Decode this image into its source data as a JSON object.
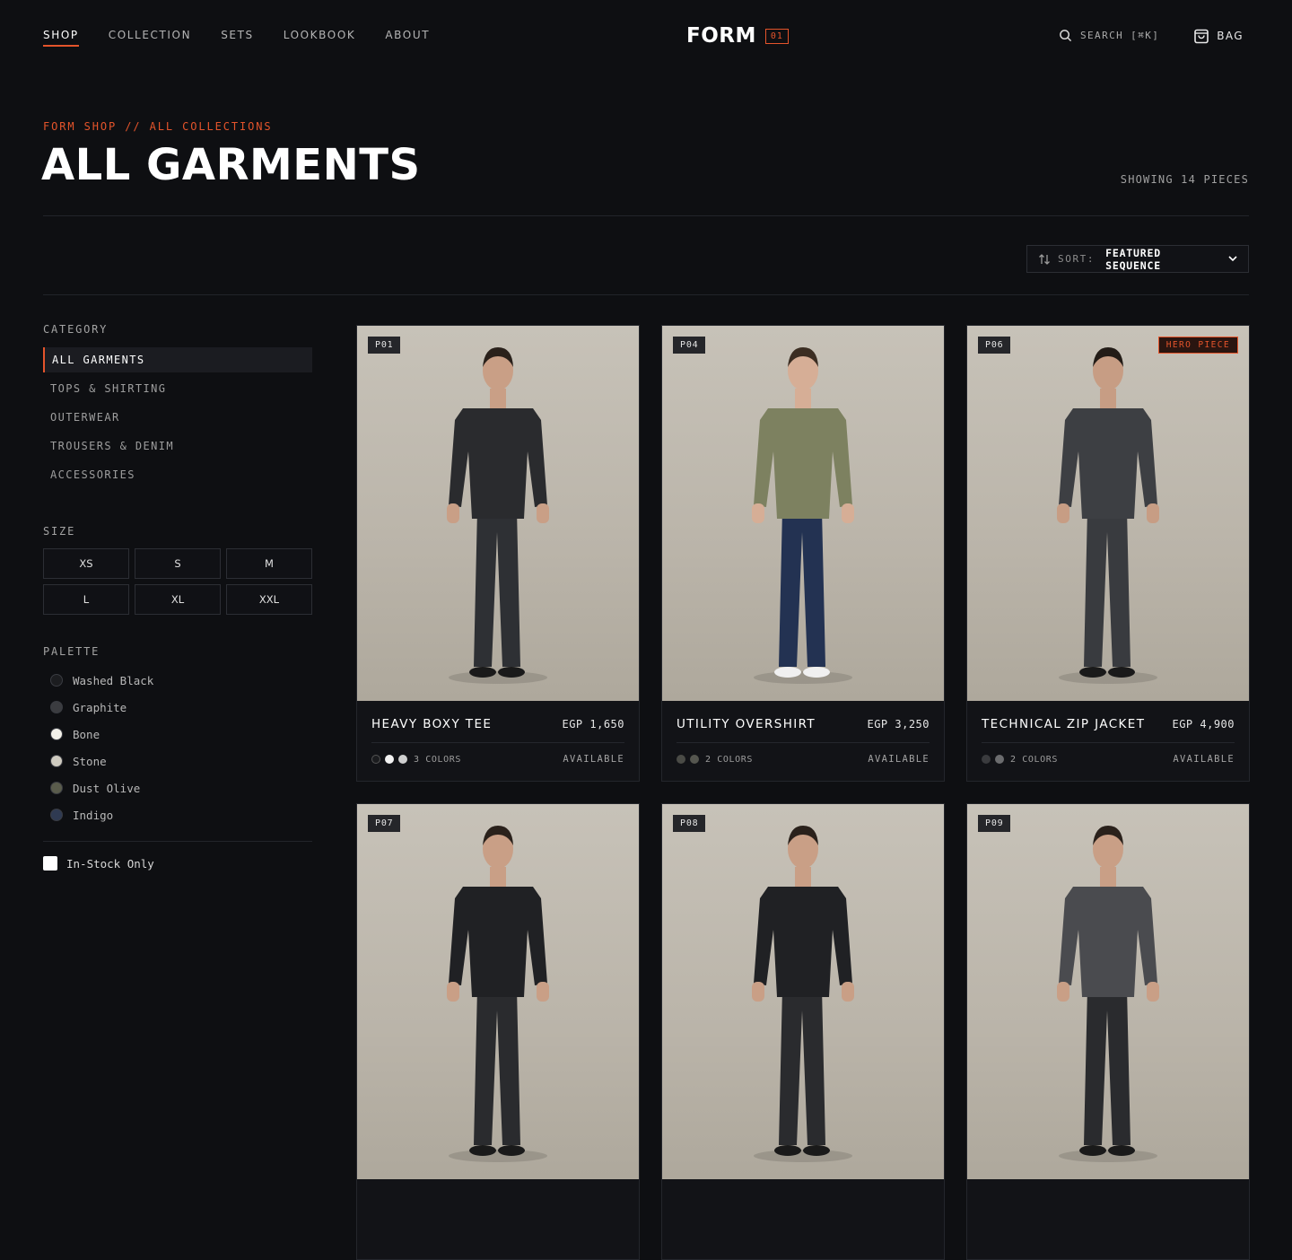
{
  "nav": {
    "items": [
      "SHOP",
      "COLLECTION",
      "SETS",
      "LOOKBOOK",
      "ABOUT"
    ],
    "active": "SHOP"
  },
  "brand": {
    "name": "FORM",
    "badge": "01"
  },
  "header": {
    "search_label": "SEARCH [⌘K]",
    "bag_label": "BAG"
  },
  "page": {
    "breadcrumb": "FORM SHOP // ALL COLLECTIONS",
    "title": "ALL GARMENTS",
    "count": "SHOWING 14 PIECES"
  },
  "sort": {
    "label": "SORT:",
    "value": "FEATURED SEQUENCE"
  },
  "filters": {
    "category_title": "CATEGORY",
    "categories": [
      "ALL GARMENTS",
      "TOPS & SHIRTING",
      "OUTERWEAR",
      "TROUSERS & DENIM",
      "ACCESSORIES"
    ],
    "size_title": "SIZE",
    "sizes": [
      "XS",
      "S",
      "M",
      "L",
      "XL",
      "XXL"
    ],
    "palette_title": "PALETTE",
    "palette": [
      {
        "name": "Washed Black",
        "color": "#1c1d20"
      },
      {
        "name": "Graphite",
        "color": "#3b3c40"
      },
      {
        "name": "Bone",
        "color": "#f3f1ea"
      },
      {
        "name": "Stone",
        "color": "#cfcbc0"
      },
      {
        "name": "Dust Olive",
        "color": "#5a5c4c"
      },
      {
        "name": "Indigo",
        "color": "#2f3a52"
      }
    ],
    "instock_label": "In-Stock Only"
  },
  "products": [
    {
      "tag": "P01",
      "name": "HEAVY BOXY TEE",
      "price": "EGP 1,650",
      "colors_label": "3 COLORS",
      "status": "AVAILABLE",
      "swatches": [
        "#1b1c1f",
        "#f2f2f2",
        "#cfcfcf"
      ],
      "hero": "",
      "top": "#2a2b2e",
      "bottom": "#2e3034",
      "shoe": "#1a1a1a",
      "skin": "#c99f86",
      "hair": "#2a211b"
    },
    {
      "tag": "P04",
      "name": "UTILITY OVERSHIRT",
      "price": "EGP 3,250",
      "colors_label": "2 COLORS",
      "status": "AVAILABLE",
      "swatches": [
        "#4a4b46",
        "#55564f"
      ],
      "hero": "",
      "top": "#7d8160",
      "bottom": "#233252",
      "shoe": "#f0f0f0",
      "skin": "#d6ae96",
      "hair": "#3b2d22"
    },
    {
      "tag": "P06",
      "name": "TECHNICAL ZIP JACKET",
      "price": "EGP 4,900",
      "colors_label": "2 COLORS",
      "status": "AVAILABLE",
      "swatches": [
        "#3a3b3e",
        "#6b6c6e"
      ],
      "hero": "HERO PIECE",
      "top": "#3d3f43",
      "bottom": "#393b3f",
      "shoe": "#1a1a1a",
      "skin": "#c79d84",
      "hair": "#231c17"
    },
    {
      "tag": "P07",
      "name": "",
      "price": "",
      "colors_label": "",
      "status": "",
      "swatches": [],
      "hero": "",
      "top": "#202124",
      "bottom": "#2a2b2e",
      "shoe": "#1a1a1a",
      "skin": "#c99f86",
      "hair": "#2a211b"
    },
    {
      "tag": "P08",
      "name": "",
      "price": "",
      "colors_label": "",
      "status": "",
      "swatches": [],
      "hero": "",
      "top": "#202124",
      "bottom": "#2a2b2e",
      "shoe": "#1a1a1a",
      "skin": "#c99f86",
      "hair": "#2a211b"
    },
    {
      "tag": "P09",
      "name": "",
      "price": "",
      "colors_label": "",
      "status": "",
      "swatches": [],
      "hero": "",
      "top": "#4a4b4f",
      "bottom": "#2a2b2e",
      "shoe": "#1a1a1a",
      "skin": "#c99f86",
      "hair": "#2a211b"
    }
  ],
  "colors": {
    "accent": "#e4542b",
    "background": "#0e0f12"
  }
}
